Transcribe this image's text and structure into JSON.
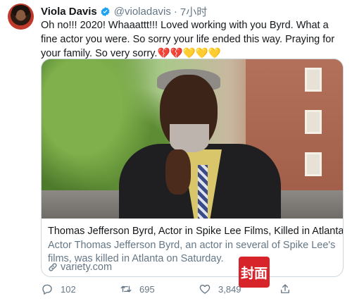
{
  "tweet": {
    "author_name": "Viola Davis",
    "handle": "@violadavis",
    "separator": "·",
    "time": "7小时",
    "text": "Oh no!!! 2020! Whaaattt!!! Loved working with you Byrd. What a fine actor you were. So sorry your life ended this way. Praying for your family. So very sorry.💔💔💛💛💛"
  },
  "card": {
    "title": "Thomas Jefferson Byrd, Actor in Spike Lee Films, Killed in Atlanta",
    "description": "Actor Thomas Jefferson Byrd, an actor in several of Spike Lee's films, was killed in Atlanta on Saturday.",
    "domain": "variety.com"
  },
  "actions": {
    "reply_count": "102",
    "retweet_count": "695",
    "like_count": "3,849"
  },
  "watermark": {
    "text": "封面"
  },
  "icons": [
    "verified-badge-icon",
    "link-icon",
    "reply-icon",
    "retweet-icon",
    "like-icon",
    "share-icon"
  ],
  "colors": {
    "accent": "#1da1f2",
    "secondary_text": "#657786",
    "watermark": "#d7242b"
  }
}
